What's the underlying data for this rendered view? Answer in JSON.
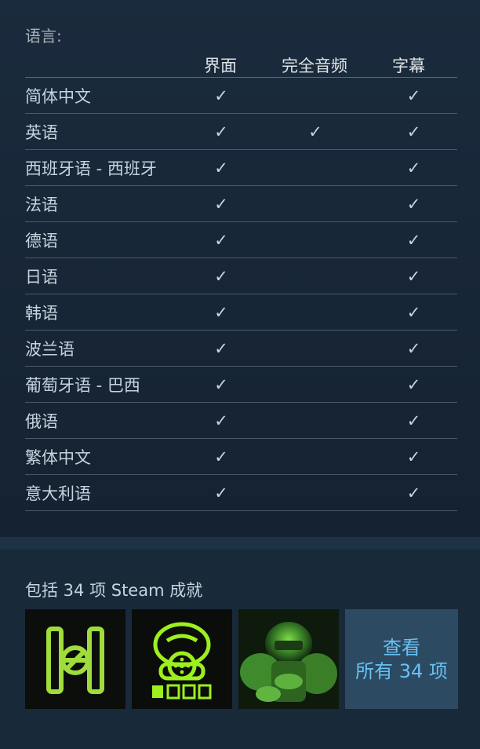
{
  "languages_section": {
    "title": "语言:",
    "columns": [
      "界面",
      "完全音频",
      "字幕"
    ],
    "rows": [
      {
        "name": "简体中文",
        "interface": true,
        "audio": false,
        "subtitles": true
      },
      {
        "name": "英语",
        "interface": true,
        "audio": true,
        "subtitles": true
      },
      {
        "name": "西班牙语 - 西班牙",
        "interface": true,
        "audio": false,
        "subtitles": true
      },
      {
        "name": "法语",
        "interface": true,
        "audio": false,
        "subtitles": true
      },
      {
        "name": "德语",
        "interface": true,
        "audio": false,
        "subtitles": true
      },
      {
        "name": "日语",
        "interface": true,
        "audio": false,
        "subtitles": true
      },
      {
        "name": "韩语",
        "interface": true,
        "audio": false,
        "subtitles": true
      },
      {
        "name": "波兰语",
        "interface": true,
        "audio": false,
        "subtitles": true
      },
      {
        "name": "葡萄牙语 - 巴西",
        "interface": true,
        "audio": false,
        "subtitles": true
      },
      {
        "name": "俄语",
        "interface": true,
        "audio": false,
        "subtitles": true
      },
      {
        "name": "繁体中文",
        "interface": true,
        "audio": false,
        "subtitles": true
      },
      {
        "name": "意大利语",
        "interface": true,
        "audio": false,
        "subtitles": true
      }
    ],
    "check_glyph": "✓"
  },
  "achievements": {
    "title": "包括 34 项 Steam 成就",
    "icons": [
      "no-entry-badge-icon",
      "gas-mask-icon",
      "armored-soldier-icon"
    ],
    "view_all_line1": "查看",
    "view_all_line2": "所有 34 项"
  },
  "colors": {
    "accent": "#66c0f4",
    "background": "#1b2838",
    "achievement_green": "#8cff3a"
  }
}
